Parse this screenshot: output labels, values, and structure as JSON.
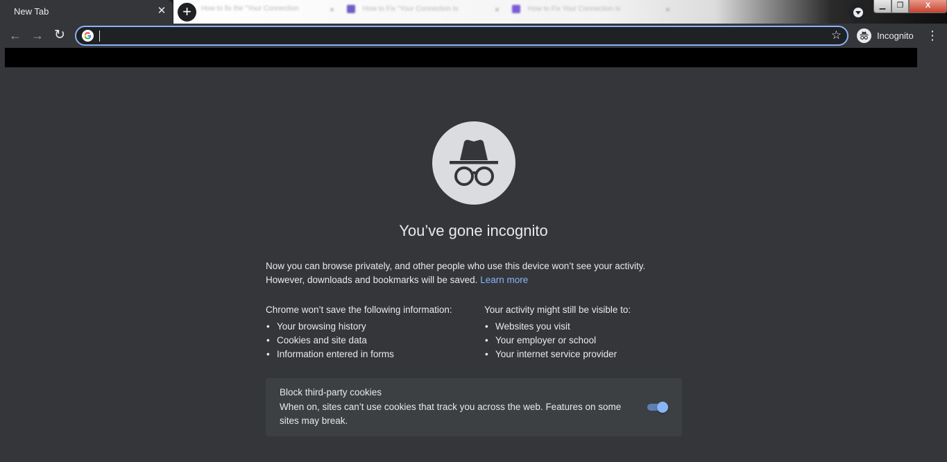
{
  "tab_strip": {
    "active_tab": {
      "title": "New Tab",
      "close_glyph": "✕"
    },
    "new_tab_glyph": "+",
    "background_tabs": [
      {
        "favicon_color": "#cfcfcf",
        "title": "How to fix the \"Your Connection"
      },
      {
        "favicon_color": "#6b5fc7",
        "title": "How to Fix \"Your Connection Is"
      },
      {
        "favicon_color": "#7c5cd6",
        "title": "How to Fix Your Connection is"
      }
    ],
    "window_controls": {
      "minimize": "▁",
      "maximize": "❐",
      "close": "X"
    }
  },
  "toolbar": {
    "back_glyph": "←",
    "forward_glyph": "→",
    "reload_glyph": "↻",
    "omnibox_value": "",
    "bookmark_glyph": "☆",
    "profile_label": "Incognito",
    "menu_glyph": "⋮"
  },
  "content": {
    "heading": "You’ve gone incognito",
    "intro_text": "Now you can browse privately, and other people who use this device won’t see your activity. However, downloads and bookmarks will be saved.",
    "learn_more": "Learn more",
    "not_saved": {
      "title": "Chrome won’t save the following information:",
      "items": [
        "Your browsing history",
        "Cookies and site data",
        "Information entered in forms"
      ]
    },
    "still_visible": {
      "title": "Your activity might still be visible to:",
      "items": [
        "Websites you visit",
        "Your employer or school",
        "Your internet service provider"
      ]
    },
    "cookie_card": {
      "title": "Block third-party cookies",
      "description": "When on, sites can’t use cookies that track you across the web. Features on some sites may break.",
      "toggle_on": true
    }
  },
  "colors": {
    "page_bg": "#35363a",
    "omnibox_focus": "#8ab4f8",
    "link": "#8ab4f8",
    "card_bg": "#3c4043"
  }
}
